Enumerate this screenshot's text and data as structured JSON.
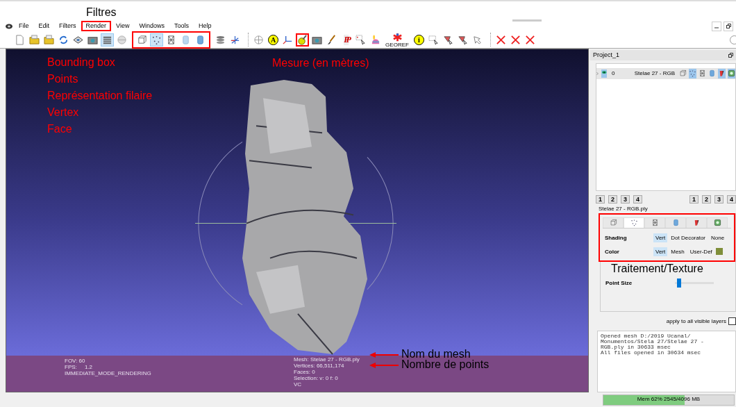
{
  "menu": [
    {
      "label": "File",
      "highlighted": false
    },
    {
      "label": "Edit",
      "highlighted": false
    },
    {
      "label": "Filters",
      "highlighted": false
    },
    {
      "label": "Render",
      "highlighted": true
    },
    {
      "label": "View",
      "highlighted": false
    },
    {
      "label": "Windows",
      "highlighted": false
    },
    {
      "label": "Tools",
      "highlighted": false
    },
    {
      "label": "Help",
      "highlighted": false
    }
  ],
  "toolbar": {
    "groups": [
      {
        "tools": [
          {
            "kind": "new",
            "selected": false
          },
          {
            "kind": "open",
            "selected": false
          },
          {
            "kind": "open",
            "selected": false
          },
          {
            "kind": "reload",
            "selected": false
          },
          {
            "kind": "save",
            "selected": false
          },
          {
            "kind": "snapshot",
            "selected": false
          },
          {
            "kind": "layers",
            "selected": true
          },
          {
            "kind": "sphere",
            "selected": false
          }
        ]
      },
      {
        "highlighted": true,
        "tools": [
          {
            "kind": "bbox",
            "selected": false
          },
          {
            "kind": "points",
            "selected": true
          },
          {
            "kind": "wire",
            "selected": false
          },
          {
            "kind": "flat",
            "selected": false
          },
          {
            "kind": "smooth",
            "selected": false
          }
        ]
      },
      {
        "tools": [
          {
            "kind": "stack",
            "selected": false
          },
          {
            "kind": "axes",
            "selected": false
          }
        ]
      },
      {
        "separator": true,
        "tools": [
          {
            "kind": "trackball",
            "selected": false
          },
          {
            "kind": "glyph",
            "glyph": "A",
            "selected": false
          },
          {
            "kind": "frame",
            "selected": false
          },
          {
            "kind": "measure",
            "selected": false,
            "highlighted": true
          },
          {
            "kind": "snapshot",
            "selected": false
          },
          {
            "kind": "brush",
            "selected": false
          },
          {
            "kind": "glyph2",
            "glyph": "PP",
            "selected": false
          },
          {
            "kind": "selpoints",
            "selected": false
          },
          {
            "kind": "bunny",
            "selected": false
          },
          {
            "kind": "georef",
            "glyph": "GEOREF",
            "selected": false
          },
          {
            "kind": "glyph",
            "glyph": "i",
            "selected": false
          },
          {
            "kind": "selrect",
            "selected": false
          },
          {
            "kind": "selfaces",
            "selected": false
          },
          {
            "kind": "selfaces",
            "selected": false
          },
          {
            "kind": "selconn",
            "selected": false
          }
        ]
      },
      {
        "separator": true,
        "tools": [
          {
            "kind": "delete",
            "selected": false
          },
          {
            "kind": "delete",
            "selected": false
          },
          {
            "kind": "delete",
            "selected": false
          }
        ]
      }
    ]
  },
  "viewport": {
    "info_left": [
      "FOV: 60",
      "FPS:     1.2",
      "IMMEDIATE_MODE_RENDERING"
    ],
    "info_right": [
      "Mesh: Stelae 27 - RGB.ply",
      "Vertices: 66,511,174",
      "Faces: 0",
      "Selection: v: 0 f: 0",
      "VC"
    ]
  },
  "project": {
    "title": "Project_1",
    "layers": [
      {
        "visible": true,
        "index": "0",
        "name": "Stelae 27 - RGB",
        "modes": [
          {
            "kind": "bbox",
            "selected": false
          },
          {
            "kind": "points",
            "selected": true
          },
          {
            "kind": "wire",
            "selected": false
          },
          {
            "kind": "smooth",
            "selected": false
          },
          {
            "kind": "texture",
            "selected": true
          },
          {
            "kind": "vcolor",
            "selected": true
          }
        ]
      }
    ]
  },
  "view_button_groups": [
    {
      "buttons": [
        "1",
        "2",
        "3",
        "4"
      ]
    },
    {
      "buttons": [
        "1",
        "2",
        "3",
        "4"
      ]
    }
  ],
  "render_panel": {
    "title": "Stelae 27 - RGB.ply",
    "highlighted": true,
    "tabs": [
      {
        "kind": "bbox",
        "selected": false
      },
      {
        "kind": "points",
        "selected": true
      },
      {
        "kind": "wire",
        "selected": false
      },
      {
        "kind": "smooth",
        "selected": false
      },
      {
        "kind": "texture",
        "selected": false
      },
      {
        "kind": "vcolor",
        "selected": false
      }
    ],
    "rows": [
      {
        "label": "Shading",
        "options": [
          {
            "label": "Vert",
            "selected": true
          },
          {
            "label": "Dot Decorator",
            "selected": false
          },
          {
            "label": "None",
            "selected": false
          }
        ]
      },
      {
        "label": "Color",
        "options": [
          {
            "label": "Vert",
            "selected": true
          },
          {
            "label": "Mesh",
            "selected": false
          },
          {
            "label": "User-Def",
            "selected": false
          }
        ],
        "swatch": {
          "color": "#7f8f3a"
        }
      }
    ],
    "point_size": {
      "label": "Point Size",
      "level": 0.1
    },
    "apply_all": {
      "label": "apply to all visible layers",
      "checked": false
    }
  },
  "log": [
    "Opened mesh D:/2019 Ucanal/ Monumentos/Stela 27/Stelae 27 - RGB.ply in 30633 msec",
    "All files opened in 30634 msec"
  ],
  "status": {
    "memory": {
      "text": "Mem 62% 2545/4096 MB",
      "level": 0.62
    }
  },
  "annotations": [
    {
      "text": "Filtres",
      "color": "#000000",
      "arrow": false
    },
    {
      "text": "Bounding box",
      "color": "#ff0000",
      "arrow": false
    },
    {
      "text": "Points",
      "color": "#ff0000",
      "arrow": false
    },
    {
      "text": "Représentation filaire",
      "color": "#ff0000",
      "arrow": false
    },
    {
      "text": "Vertex",
      "color": "#ff0000",
      "arrow": false
    },
    {
      "text": "Face",
      "color": "#ff0000",
      "arrow": false
    },
    {
      "text": "Mesure (en mètres)",
      "color": "#ff0000",
      "arrow": false
    },
    {
      "text": "Traitement/Texture",
      "color": "#000000",
      "arrow": false
    },
    {
      "text": "Nom du mesh",
      "color": "#000000",
      "arrow": true
    },
    {
      "text": "Nombre de points",
      "color": "#000000",
      "arrow": true
    }
  ]
}
